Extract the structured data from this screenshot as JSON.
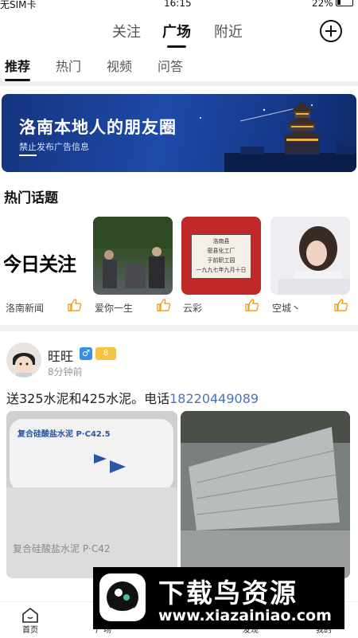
{
  "status_bar": {
    "carrier": "无SIM卡",
    "time": "16:15",
    "battery": "22%"
  },
  "top_tabs": [
    {
      "label": "关注",
      "active": false
    },
    {
      "label": "广场",
      "active": true
    },
    {
      "label": "附近",
      "active": false
    }
  ],
  "sub_tabs": [
    {
      "label": "推荐",
      "active": true
    },
    {
      "label": "热门",
      "active": false
    },
    {
      "label": "视频",
      "active": false
    },
    {
      "label": "问答",
      "active": false
    }
  ],
  "banner": {
    "title": "洛南本地人的朋友圈",
    "subtitle": "禁止发布广告信息"
  },
  "hot_topics": {
    "title": "热门话题",
    "items": [
      {
        "name": "洛南新闻",
        "thumb_text": "今日关注"
      },
      {
        "name": "爱你一生"
      },
      {
        "name": "云彩",
        "thumb_lines": [
          "洛南县",
          "密县化工厂",
          "于前职工园",
          "一九九七年九月十日"
        ]
      },
      {
        "name": "空城丶"
      }
    ]
  },
  "post": {
    "username": "旺旺",
    "gender_icon": "♂",
    "level": "8",
    "time": "8分钟前",
    "text": "送325水泥和425水泥。电话",
    "phone": "18220449089",
    "bag_text": "复合硅酸盐水泥 P·C42.5",
    "bag_text_bottom": "复合硅酸盐水泥 P·C42"
  },
  "bottom_nav": [
    {
      "label": "首页",
      "icon": "home-icon"
    },
    {
      "label": "广场",
      "icon": "square-icon"
    },
    {
      "label": "",
      "icon": "publish-icon"
    },
    {
      "label": "发现",
      "icon": "discover-icon"
    },
    {
      "label": "我的",
      "icon": "profile-icon"
    }
  ],
  "watermark": {
    "title": "下载鸟资源",
    "url": "www.xiazainiao.com"
  }
}
